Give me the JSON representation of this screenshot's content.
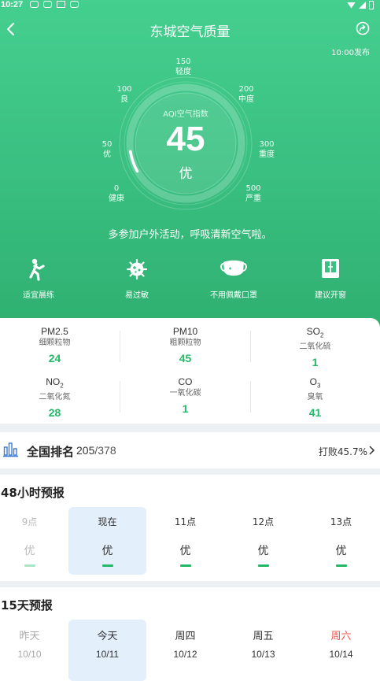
{
  "statusbar": {
    "time": "10:27"
  },
  "header": {
    "title": "东城空气质量",
    "publish_time": "10:00发布"
  },
  "gauge": {
    "center_label": "AQI空气指数",
    "aqi_value": "45",
    "aqi_level": "优",
    "progress_fraction": 0.09,
    "scale": [
      {
        "value": "0",
        "label": "健康"
      },
      {
        "value": "50",
        "label": "优"
      },
      {
        "value": "100",
        "label": "良"
      },
      {
        "value": "150",
        "label": "轻度"
      },
      {
        "value": "200",
        "label": "中度"
      },
      {
        "value": "300",
        "label": "重度"
      },
      {
        "value": "500",
        "label": "严重"
      }
    ]
  },
  "advice": "多参加户外活动，呼吸清新空气啦。",
  "tips": [
    {
      "label": "适宜晨练",
      "icon": "running-person-icon"
    },
    {
      "label": "易过敏",
      "icon": "virus-icon"
    },
    {
      "label": "不用佩戴口罩",
      "icon": "face-mask-icon"
    },
    {
      "label": "建议开窗",
      "icon": "open-window-icon"
    }
  ],
  "pollutants": [
    {
      "name": "PM2.5",
      "cn": "细颗粒物",
      "value": "24"
    },
    {
      "name": "PM10",
      "cn": "粗颗粒物",
      "value": "45"
    },
    {
      "name": "SO",
      "sub": "2",
      "cn": "二氧化硫",
      "value": "1"
    },
    {
      "name": "NO",
      "sub": "2",
      "cn": "二氧化氮",
      "value": "28"
    },
    {
      "name": "CO",
      "cn": "一氧化碳",
      "value": "1"
    },
    {
      "name": "O",
      "sub": "3",
      "cn": "臭氧",
      "value": "41"
    }
  ],
  "ranking": {
    "label": "全国排名",
    "rank": "205",
    "total": "/378",
    "beat": "打败45.7%"
  },
  "hourly": {
    "title": "48小时预报",
    "items": [
      {
        "time": "9点",
        "level": "优"
      },
      {
        "time": "现在",
        "level": "优"
      },
      {
        "time": "11点",
        "level": "优"
      },
      {
        "time": "12点",
        "level": "优"
      },
      {
        "time": "13点",
        "level": "优"
      }
    ]
  },
  "daily": {
    "title": "15天预报",
    "items": [
      {
        "day": "昨天",
        "date": "10/10"
      },
      {
        "day": "今天",
        "date": "10/11"
      },
      {
        "day": "周四",
        "date": "10/12"
      },
      {
        "day": "周五",
        "date": "10/13"
      },
      {
        "day": "周六",
        "date": "10/14"
      }
    ]
  },
  "colors": {
    "hero_green": "#3bc283",
    "value_green": "#23b768",
    "weekend_red": "#f0534a",
    "selected_bg": "#e3effb"
  }
}
